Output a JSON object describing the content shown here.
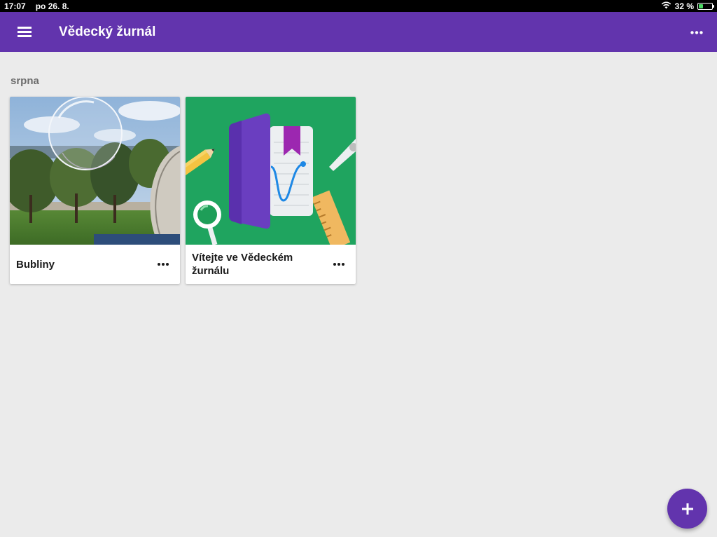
{
  "status_bar": {
    "time": "17:07",
    "date": "po 26. 8.",
    "battery_percent": "32 %",
    "battery_level": 0.32,
    "icons": [
      "wifi-icon",
      "battery-icon"
    ]
  },
  "app_bar": {
    "title": "Vědecký žurnál",
    "color": "#6234ad",
    "icons": [
      "menu-icon",
      "more-horizontal-icon"
    ]
  },
  "section": {
    "label": "srpna"
  },
  "cards": [
    {
      "title": "Bubliny",
      "image": "bubble-photo"
    },
    {
      "title": "Vítejte ve Vědeckém žurnálu",
      "image": "notebook-illustration"
    }
  ],
  "fab": {
    "icon": "plus-icon",
    "color": "#6234ad"
  }
}
